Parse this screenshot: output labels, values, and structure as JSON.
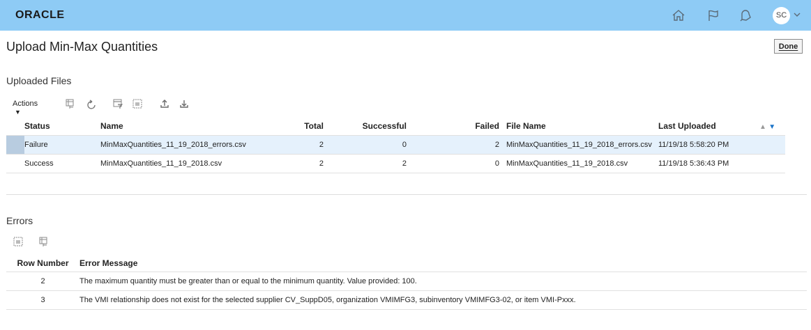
{
  "header": {
    "logo": "ORACLE",
    "avatar_initials": "SC",
    "icons": [
      "home-icon",
      "flag-icon",
      "notifications-icon",
      "chevron-down-icon"
    ]
  },
  "page": {
    "title": "Upload Min-Max Quantities",
    "done_label": "Done"
  },
  "uploaded_files": {
    "title": "Uploaded Files",
    "actions_label": "Actions",
    "toolbar_icons": [
      "freeze-icon",
      "refresh-icon",
      "query-by-example-icon",
      "detach-icon",
      "upload-icon",
      "download-icon"
    ],
    "columns": [
      "Status",
      "Name",
      "Total",
      "Successful",
      "Failed",
      "File Name",
      "Last Uploaded"
    ],
    "rows": [
      {
        "status": "Failure",
        "name": "MinMaxQuantities_11_19_2018_errors.csv",
        "total": "2",
        "successful": "0",
        "failed": "2",
        "file_name": "MinMaxQuantities_11_19_2018_errors.csv",
        "last_uploaded": "11/19/18 5:58:20 PM"
      },
      {
        "status": "Success",
        "name": "MinMaxQuantities_11_19_2018.csv",
        "total": "2",
        "successful": "2",
        "failed": "0",
        "file_name": "MinMaxQuantities_11_19_2018.csv",
        "last_uploaded": "11/19/18 5:36:43 PM"
      }
    ]
  },
  "errors": {
    "title": "Errors",
    "toolbar_icons": [
      "detach-icon",
      "freeze-icon"
    ],
    "columns": [
      "Row Number",
      "Error Message"
    ],
    "rows": [
      {
        "row_number": "2",
        "message": "The maximum quantity must be greater than or equal to the minimum quantity. Value provided: 100."
      },
      {
        "row_number": "3",
        "message": "The VMI relationship does not exist for the selected supplier CV_SuppD05, organization VMIMFG3, subinventory VMIMFG3-02, or item VMI-Pxxx."
      }
    ]
  },
  "colors": {
    "header_bg": "#8ecbf5",
    "link": "#0a5da0",
    "failed_value": "#c4171f",
    "selected_row": "#e5f1fc",
    "sort_desc_active": "#1a73c8"
  }
}
